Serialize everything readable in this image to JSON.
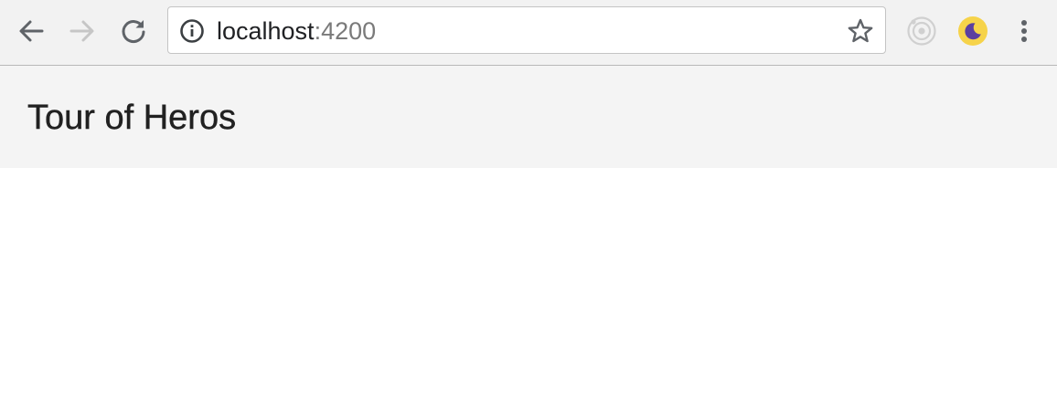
{
  "browser": {
    "url": {
      "host": "localhost",
      "port": ":4200"
    },
    "icons": {
      "back": "back-arrow-icon",
      "forward": "forward-arrow-icon",
      "reload": "reload-icon",
      "site_info": "info-icon",
      "bookmark": "star-icon",
      "extension_1": "target-icon",
      "extension_2": "moon-icon",
      "menu": "kebab-menu-icon"
    },
    "colors": {
      "toolbar_bg": "#f2f2f2",
      "icon_active": "#5f6368",
      "icon_disabled": "#c6c6c6",
      "extension_moon_bg": "#f6d34a",
      "extension_moon_fg": "#5b3fa0"
    }
  },
  "app": {
    "title": "Tour of Heros",
    "colors": {
      "header_bg": "#f4f4f4",
      "title_text": "#212121"
    }
  }
}
